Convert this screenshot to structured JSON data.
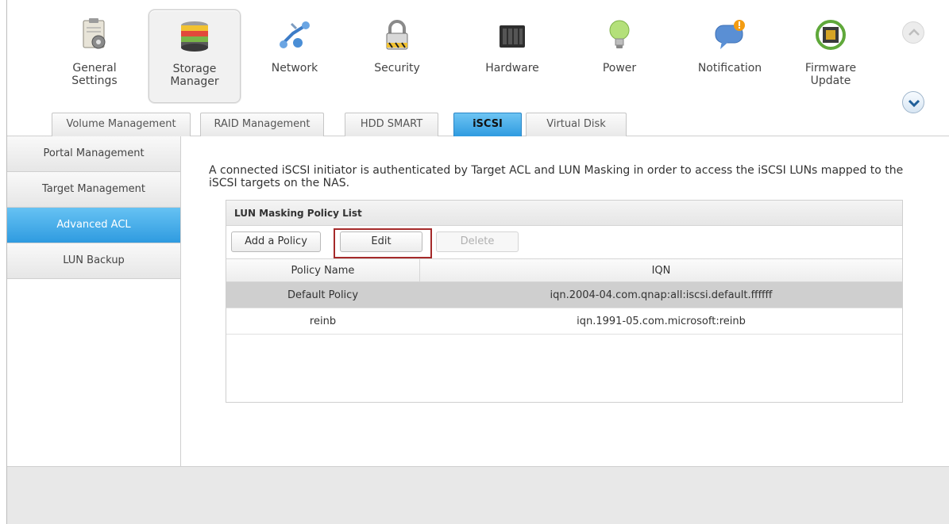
{
  "topnav": {
    "items": [
      {
        "label": "General\nSettings",
        "icon": "general-settings-icon"
      },
      {
        "label": "Storage\nManager",
        "icon": "storage-manager-icon"
      },
      {
        "label": "Network",
        "icon": "network-icon"
      },
      {
        "label": "Security",
        "icon": "security-lock-icon"
      },
      {
        "label": "Hardware",
        "icon": "hardware-nas-icon"
      },
      {
        "label": "Power",
        "icon": "power-bulb-icon"
      },
      {
        "label": "Notification",
        "icon": "notification-icon"
      },
      {
        "label": "Firmware\nUpdate",
        "icon": "firmware-update-icon"
      }
    ],
    "selected": "Storage Manager",
    "scroll_up_icon": "chevron-up-icon",
    "scroll_down_icon": "chevron-down-icon"
  },
  "tabs": [
    {
      "label": "Volume Management"
    },
    {
      "label": "RAID Management"
    },
    {
      "label": "HDD SMART"
    },
    {
      "label": "iSCSI"
    },
    {
      "label": "Virtual Disk"
    }
  ],
  "active_tab": "iSCSI",
  "sidebar": {
    "items": [
      {
        "label": "Portal Management"
      },
      {
        "label": "Target Management"
      },
      {
        "label": "Advanced ACL"
      },
      {
        "label": "LUN Backup"
      }
    ],
    "active": "Advanced ACL"
  },
  "main": {
    "description": "A connected iSCSI initiator is authenticated by Target ACL and LUN Masking in order to access the iSCSI LUNs mapped to the iSCSI targets on the NAS.",
    "panel": {
      "title": "LUN Masking Policy List",
      "buttons": {
        "add": "Add a Policy",
        "edit": "Edit",
        "delete": "Delete"
      },
      "columns": [
        "Policy Name",
        "IQN"
      ],
      "rows": [
        {
          "policy_name": "Default Policy",
          "iqn": "iqn.2004-04.com.qnap:all:iscsi.default.ffffff",
          "selected": true
        },
        {
          "policy_name": "reinb",
          "iqn": "iqn.1991-05.com.microsoft:reinb",
          "selected": false
        }
      ]
    }
  },
  "colors": {
    "accent_blue": "#2f9be0",
    "highlight_red": "#a52a2a"
  }
}
